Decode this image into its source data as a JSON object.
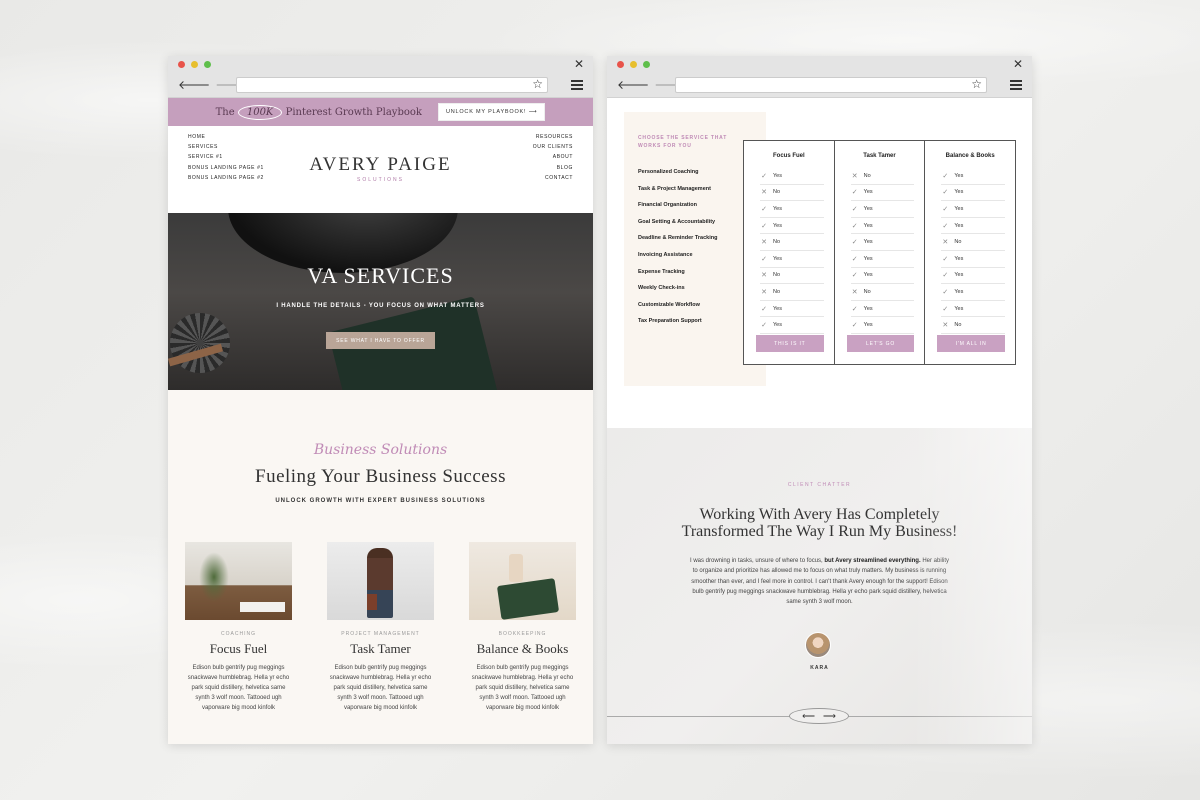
{
  "browser": {
    "back_icon": "back-arrow-icon",
    "forward_icon": "forward-arrow-icon",
    "home_icon": "home-icon",
    "star_icon": "bookmark-star-icon",
    "menu_icon": "hamburger-menu-icon"
  },
  "left": {
    "promo": {
      "prefix": "The",
      "highlight": "100K",
      "suffix": "Pinterest Growth Playbook",
      "button": "UNLOCK MY PLAYBOOK!",
      "button_arrow": "⟶"
    },
    "nav_left": [
      "HOME",
      "SERVICES",
      "SERVICE #1",
      "BONUS LANDING PAGE #1",
      "BONUS LANDING PAGE #2"
    ],
    "nav_right": [
      "RESOURCES",
      "OUR CLIENTS",
      "ABOUT",
      "BLOG",
      "CONTACT"
    ],
    "logo": {
      "main": "AVERY PAIGE",
      "sub": "SOLUTIONS"
    },
    "hero": {
      "title": "VA SERVICES",
      "tagline": "I HANDLE THE DETAILS - YOU FOCUS ON WHAT MATTERS",
      "button": "SEE WHAT I HAVE TO OFFER"
    },
    "services": {
      "script": "Business Solutions",
      "title": "Fueling Your Business Success",
      "subtitle": "UNLOCK GROWTH WITH EXPERT BUSINESS SOLUTIONS",
      "cards": [
        {
          "tag": "COACHING",
          "title": "Focus Fuel",
          "body": "Edison bulb gentrify pug meggings snackwave humblebrag. Hella yr echo park squid distillery, helvetica same synth 3 wolf moon. Tattooed ugh vaporware big mood kinfolk"
        },
        {
          "tag": "PROJECT MANAGEMENT",
          "title": "Task Tamer",
          "body": "Edison bulb gentrify pug meggings snackwave humblebrag. Hella yr echo park squid distillery, helvetica same synth 3 wolf moon. Tattooed ugh vaporware big mood kinfolk"
        },
        {
          "tag": "BOOKKEEPING",
          "title": "Balance & Books",
          "body": "Edison bulb gentrify pug meggings snackwave humblebrag. Hella yr echo park squid distillery, helvetica same synth 3 wolf moon. Tattooed ugh vaporware big mood kinfolk"
        }
      ]
    }
  },
  "right": {
    "pricing": {
      "kicker": "CHOOSE THE SERVICE THAT WORKS FOR YOU",
      "features": [
        "Personalized Coaching",
        "Task & Project Management",
        "Financial Organization",
        "Goal Setting & Accountability",
        "Deadline & Reminder Tracking",
        "Invoicing Assistance",
        "Expense Tracking",
        "Weekly Check-ins",
        "Customizable Workflow",
        "Tax Preparation Support"
      ],
      "plans": [
        {
          "name": "Focus Fuel",
          "button": "THIS IS IT",
          "rows": [
            {
              "mark": "✓",
              "label": "Yes"
            },
            {
              "mark": "✕",
              "label": "No"
            },
            {
              "mark": "✓",
              "label": "Yes"
            },
            {
              "mark": "✓",
              "label": "Yes"
            },
            {
              "mark": "✕",
              "label": "No"
            },
            {
              "mark": "✓",
              "label": "Yes"
            },
            {
              "mark": "✕",
              "label": "No"
            },
            {
              "mark": "✕",
              "label": "No"
            },
            {
              "mark": "✓",
              "label": "Yes"
            },
            {
              "mark": "✓",
              "label": "Yes"
            }
          ]
        },
        {
          "name": "Task Tamer",
          "button": "LET'S GO",
          "rows": [
            {
              "mark": "✕",
              "label": "No"
            },
            {
              "mark": "✓",
              "label": "Yes"
            },
            {
              "mark": "✓",
              "label": "Yes"
            },
            {
              "mark": "✓",
              "label": "Yes"
            },
            {
              "mark": "✓",
              "label": "Yes"
            },
            {
              "mark": "✓",
              "label": "Yes"
            },
            {
              "mark": "✓",
              "label": "Yes"
            },
            {
              "mark": "✕",
              "label": "No"
            },
            {
              "mark": "✓",
              "label": "Yes"
            },
            {
              "mark": "✓",
              "label": "Yes"
            }
          ]
        },
        {
          "name": "Balance & Books",
          "button": "I'M ALL IN",
          "rows": [
            {
              "mark": "✓",
              "label": "Yes"
            },
            {
              "mark": "✓",
              "label": "Yes"
            },
            {
              "mark": "✓",
              "label": "Yes"
            },
            {
              "mark": "✓",
              "label": "Yes"
            },
            {
              "mark": "✕",
              "label": "No"
            },
            {
              "mark": "✓",
              "label": "Yes"
            },
            {
              "mark": "✓",
              "label": "Yes"
            },
            {
              "mark": "✓",
              "label": "Yes"
            },
            {
              "mark": "✓",
              "label": "Yes"
            },
            {
              "mark": "✕",
              "label": "No"
            }
          ]
        }
      ]
    },
    "testimonial": {
      "kicker": "CLIENT CHATTER",
      "quote": "Working With Avery Has Completely Transformed The Way I Run My Business!",
      "body_lead": "I was drowning in tasks, unsure of where to focus, ",
      "body_bold": "but Avery streamlined everything.",
      "body_rest": " Her ability to organize and prioritize has allowed me to focus on what truly matters. My business is running smoother than ever, and I feel more in control. I can't thank Avery enough for the support! Edison bulb gentrify pug meggings snackwave humblebrag. Hella yr echo park squid distillery, helvetica same synth 3 wolf moon.",
      "name": "KARA",
      "prev": "⟵",
      "next": "⟶"
    }
  },
  "colors": {
    "accent": "#c59fbd",
    "button_tan": "#b9a597",
    "cream": "#faf7f3"
  }
}
